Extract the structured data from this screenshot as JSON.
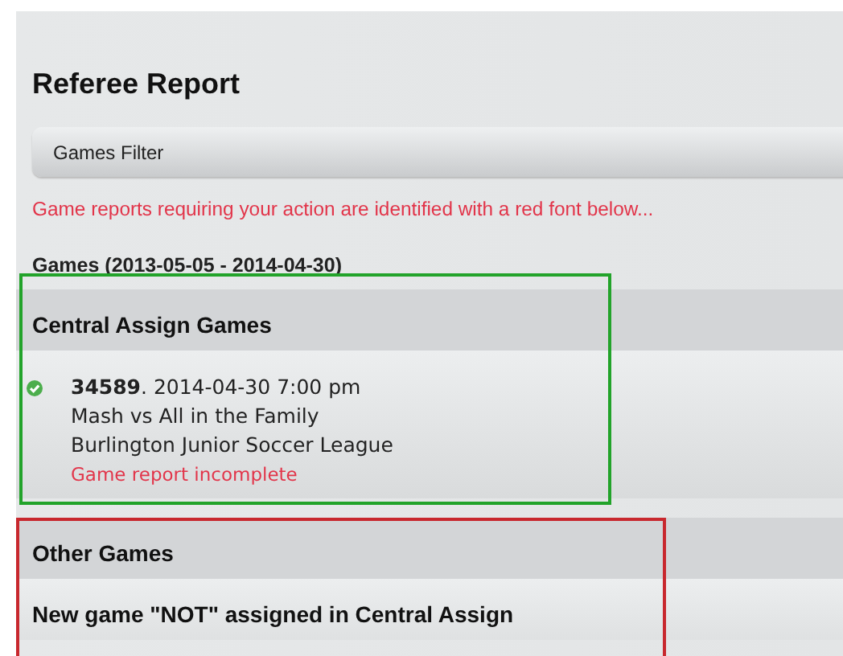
{
  "title": "Referee Report",
  "filter": {
    "label": "Games Filter",
    "expanded": false
  },
  "notice": "Game reports requiring your action are identified with a red font below...",
  "games_heading": "Games (2013-05-05 - 2014-04-30)",
  "sections": [
    {
      "heading": "Central Assign Games",
      "color": "#22a32a",
      "games": [
        {
          "line_1": "**34589**. 2014-04-30 7:00 pm",
          "line_2": "Mash vs All in the Family",
          "line_3": "Burlington Junior Soccer League",
          "status": "Game report incomplete",
          "needs_action": true,
          "checked": true
        }
      ]
    },
    {
      "heading": "Other Games",
      "color": "#c8282e",
      "subheadings": [
        "New game \"NOT\" assigned in Central Assign"
      ]
    }
  ]
}
